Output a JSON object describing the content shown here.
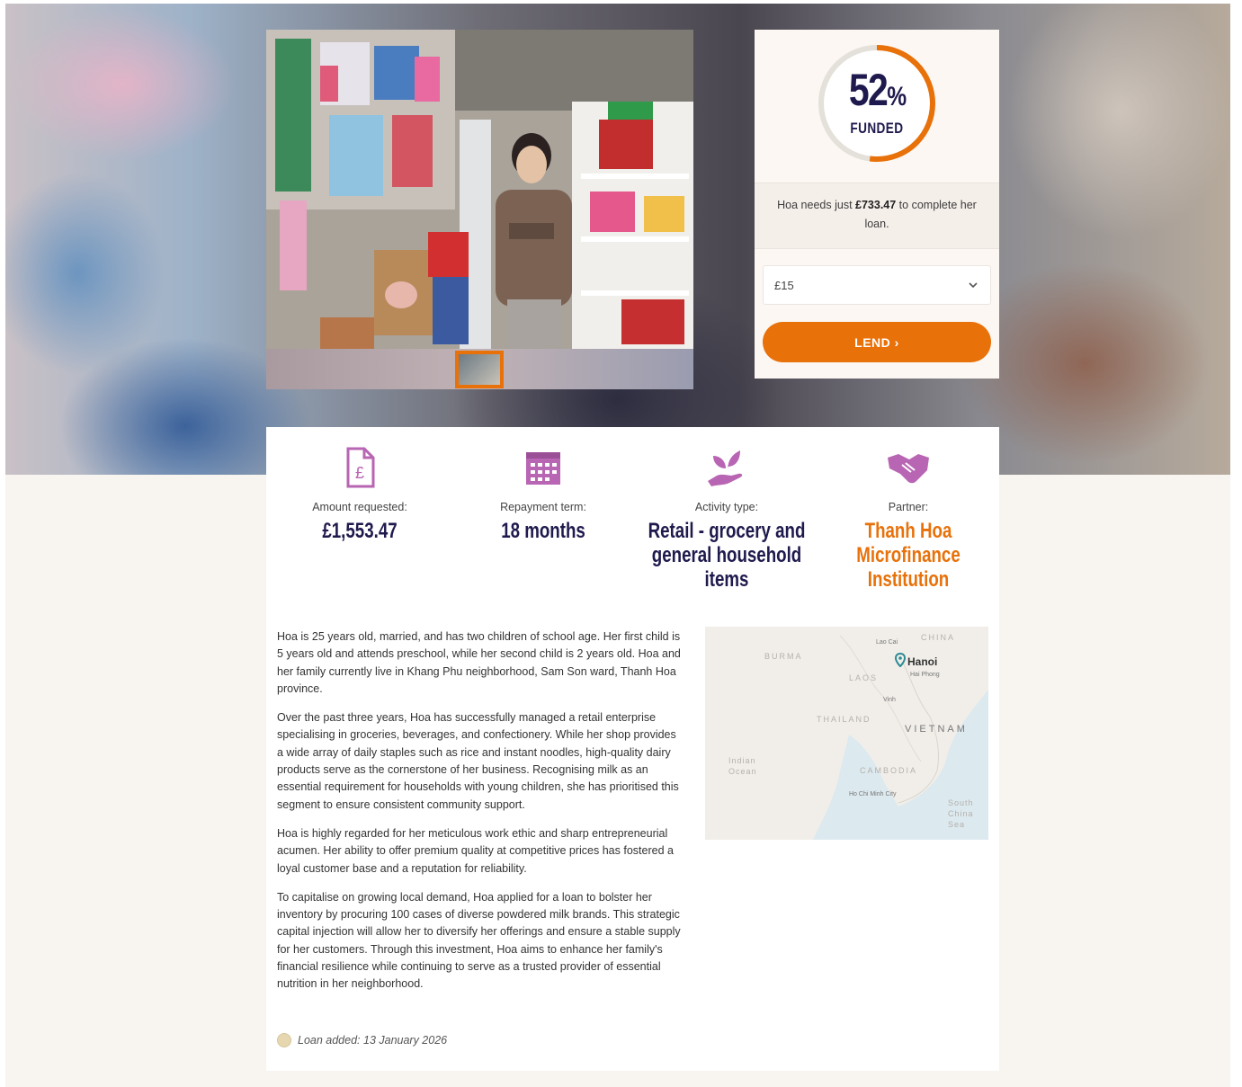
{
  "funding": {
    "percent_number": "52",
    "percent_sign": "%",
    "percent_value": 52,
    "funded_label": "FUNDED",
    "needs_prefix": "Hoa needs just ",
    "needs_amount": "£733.47",
    "needs_suffix": " to complete her loan.",
    "select_value": "£15",
    "lend_label": "LEND ›",
    "accent_color": "#e8710a",
    "track_color": "#e4e0da"
  },
  "stats": [
    {
      "label": "Amount requested:",
      "value": "£1,553.47",
      "icon": "document-pound-icon"
    },
    {
      "label": "Repayment term:",
      "value": "18 months",
      "icon": "calendar-icon"
    },
    {
      "label": "Activity type:",
      "value": "Retail - grocery and general household items",
      "icon": "plant-hand-icon"
    },
    {
      "label": "Partner:",
      "value": "Thanh Hoa Microfinance Institution",
      "icon": "handshake-icon"
    }
  ],
  "story": [
    "Hoa is 25 years old, married, and has two children of school age. Her first child is 5 years old and attends preschool, while her second child is 2 years old. Hoa and her family currently live in Khang Phu neighborhood, Sam Son ward, Thanh Hoa province.",
    "Over the past three years, Hoa has successfully managed a retail enterprise specialising in groceries, beverages, and confectionery. While her shop provides a wide array of daily staples such as rice and instant noodles, high-quality dairy products serve as the cornerstone of her business. Recognising milk as an essential requirement for households with young children, she has prioritised this segment to ensure consistent community support.",
    "Hoa is highly regarded for her meticulous work ethic and sharp entrepreneurial acumen. Her ability to offer premium quality at competitive prices has fostered a loyal customer base and a reputation for reliability.",
    "To capitalise on growing local demand, Hoa applied for a loan to bolster her inventory by procuring 100 cases of diverse powdered milk brands. This strategic capital injection will allow her to diversify her offerings and ensure a stable supply for her customers. Through this investment, Hoa aims to enhance her family's financial resilience while continuing to serve as a trusted provider of essential nutrition in her neighborhood."
  ],
  "loan_added": "Loan added: 13 January 2026",
  "map": {
    "location": "Hanoi",
    "labels": [
      "BURMA",
      "LAOS",
      "THAILAND",
      "VIETNAM",
      "CAMBODIA",
      "CHINA",
      "Indian Ocean",
      "South China Sea",
      "Lao Cai",
      "Hai Phong",
      "Vinh",
      "Ho Chi Minh City"
    ]
  }
}
